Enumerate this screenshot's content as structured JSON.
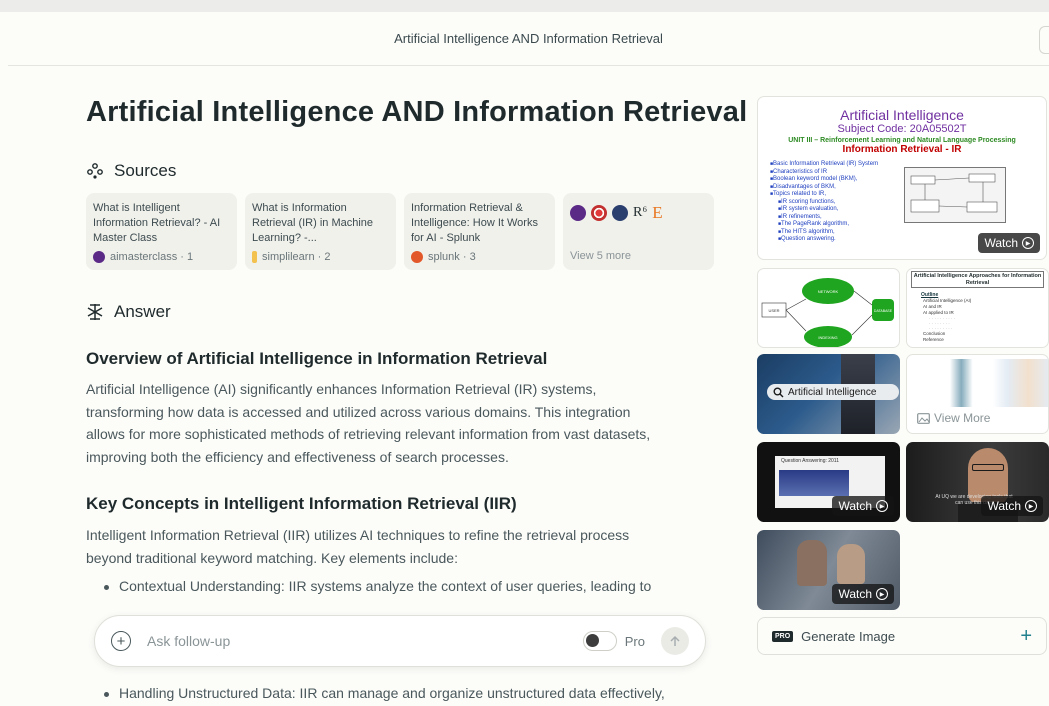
{
  "header": {
    "title": "Artificial Intelligence AND Information Retrieval"
  },
  "main": {
    "title": "Artificial Intelligence AND Information Retrieval",
    "sources_label": "Sources",
    "sources": [
      {
        "title": "What is Intelligent Information Retrieval? - AI Master Class",
        "meta": "aimasterclass · 1",
        "color": "#5b2a86"
      },
      {
        "title": "What is Information Retrieval (IR) in Machine Learning? -...",
        "meta": "simplilearn · 2",
        "color": "#f2c14e"
      },
      {
        "title": "Information Retrieval & Intelligence: How It Works for AI - Splunk",
        "meta": "splunk · 3",
        "color": "#e2582a"
      }
    ],
    "more_sources": {
      "label": "View 5 more",
      "icon_r": "R⁶",
      "icon_e": "E"
    },
    "answer_label": "Answer",
    "heading1": "Overview of Artificial Intelligence in Information Retrieval",
    "para1_lines": [
      "Artificial Intelligence (AI) significantly enhances Information Retrieval (IR) systems,",
      "transforming how data is accessed and utilized across various domains. This integration",
      "allows for more sophisticated methods of retrieving relevant information from vast datasets,",
      "improving both the efficiency and effectiveness of search processes."
    ],
    "heading2": "Key Concepts in Intelligent Information Retrieval (IIR)",
    "para2_lines": [
      "Intelligent Information Retrieval (IIR) utilizes AI techniques to refine the retrieval process",
      "beyond traditional keyword matching. Key elements include:"
    ],
    "bullets": [
      "Contextual Understanding: IIR systems analyze the context of user queries, leading to",
      "Handling Unstructured Data: IIR can manage and organize unstructured data effectively,"
    ]
  },
  "ask": {
    "placeholder": "Ask follow-up",
    "pro_label": "Pro",
    "pro_enabled": false
  },
  "media": {
    "watch_label": "Watch",
    "view_more_label": "View More",
    "slide": {
      "title": "Artificial Intelligence",
      "subject": "Subject Code: 20A05502T",
      "unit": "UNIT III – Reinforcement Learning and Natural Language Processing",
      "topic": "Information Retrieval - IR",
      "bullets": [
        "Basic Information Retrieval (IR) System",
        "Characteristics of IR",
        "Boolean keyword model (BKM),",
        "Disadvantages of BKM,",
        "Topics related to IR,",
        "IR scoring functions,",
        "IR system evaluation,",
        "IR refinements,",
        "The PageRank algorithm,",
        "The HITS algorithm,",
        "Question answering."
      ]
    },
    "slide2": {
      "title": "Artificial Intelligence Approaches for Information Retrieval",
      "outline_label": "Outline",
      "outline": [
        "Artificial Intelligence (AI)",
        "AI and IR",
        "AI applied to IR",
        "Conclusion",
        "Reference"
      ]
    },
    "diagram_labels": [
      "NETWORK",
      "DATABASE",
      "USER",
      "INDEXING"
    ],
    "search_overlay": "Artificial Intelligence",
    "video_caption": "Question Answering: 2011",
    "video_caption2": "At UQ we are developing tools that can use this data"
  },
  "generate": {
    "badge": "PRO",
    "label": "Generate Image"
  }
}
